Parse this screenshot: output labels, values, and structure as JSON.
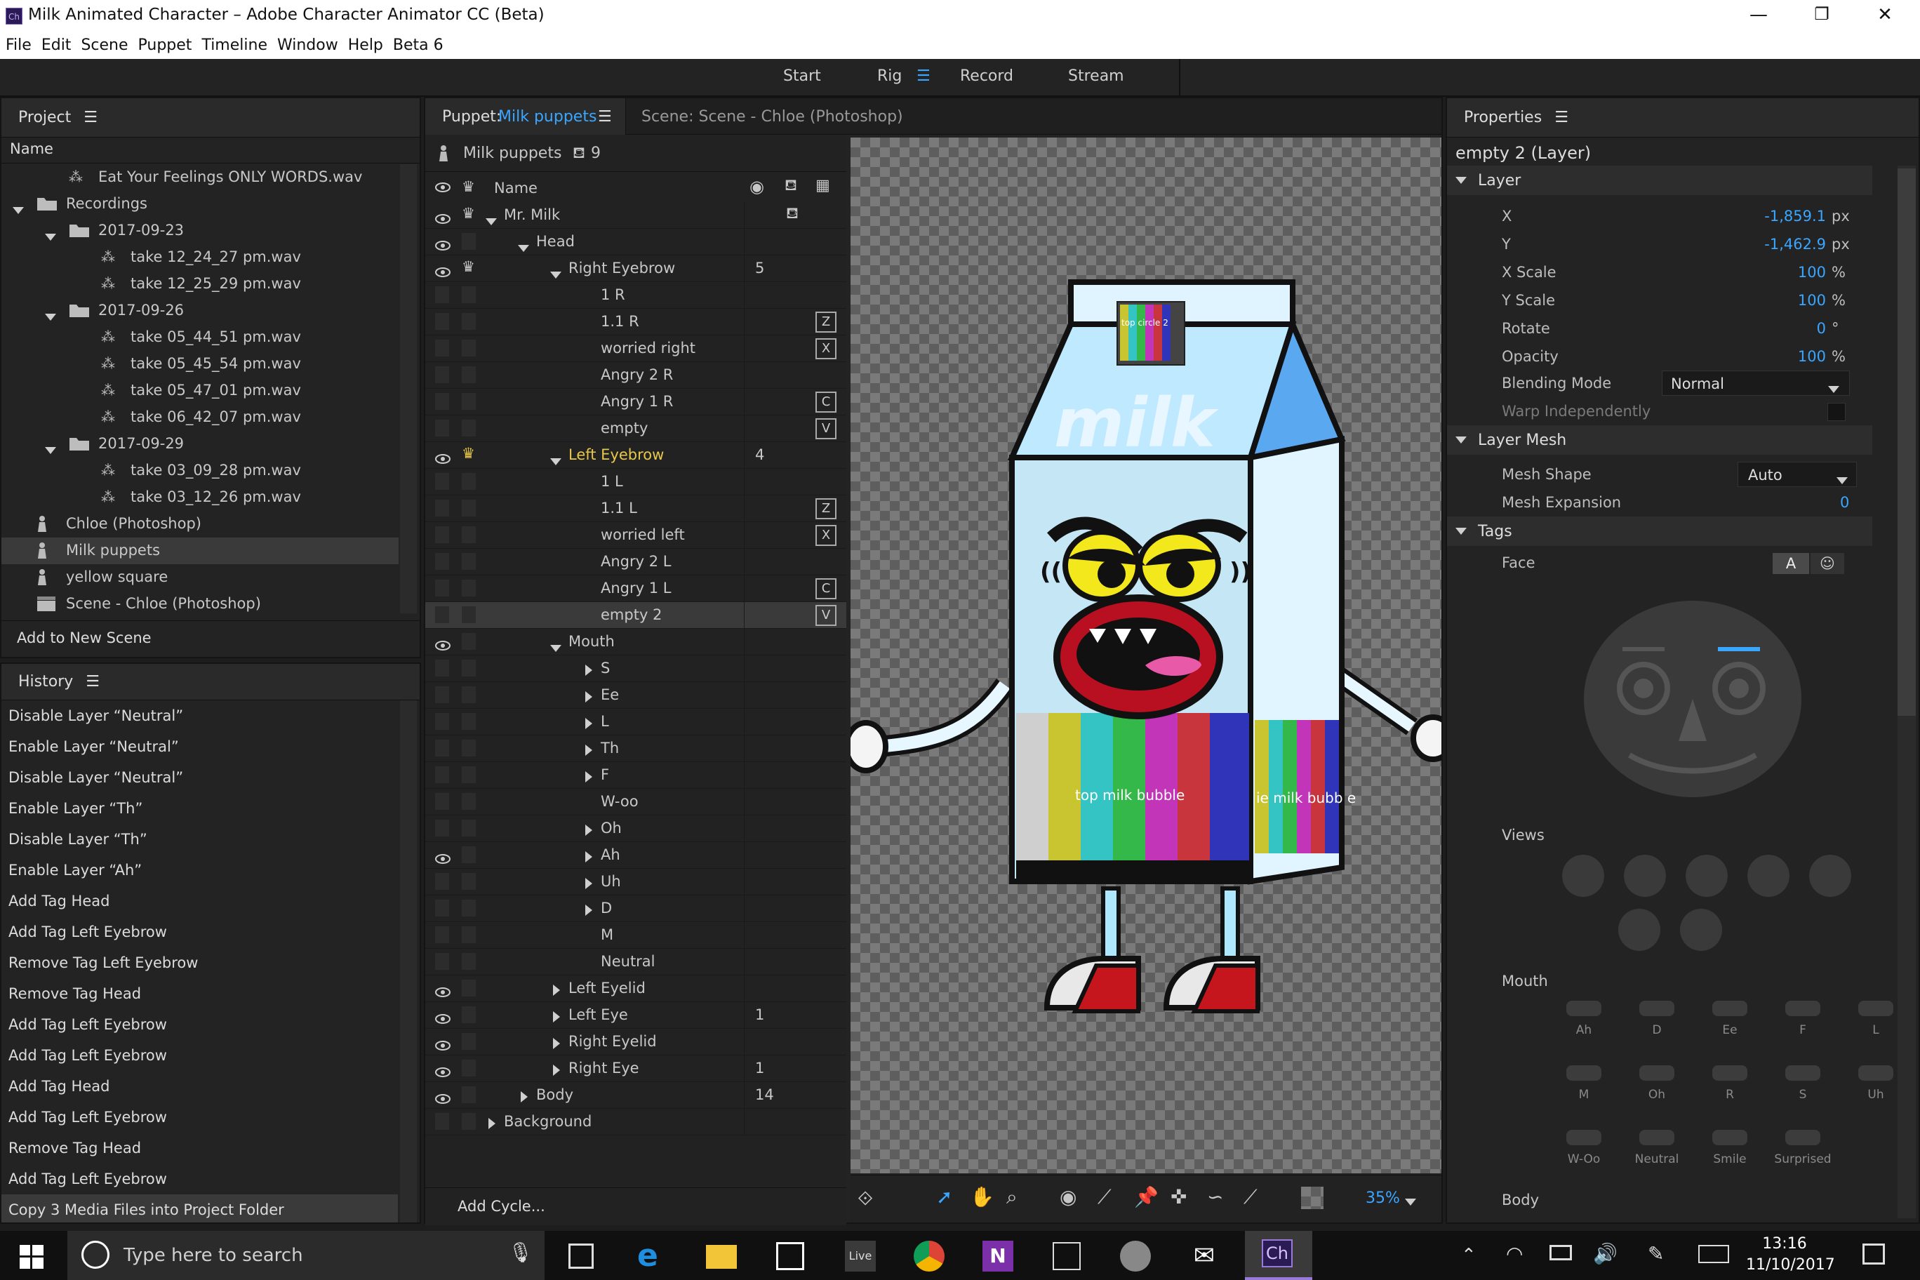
{
  "window": {
    "title": "Milk Animated Character – Adobe Character Animator CC (Beta)",
    "app_icon": "Ch"
  },
  "menu": [
    "File",
    "Edit",
    "Scene",
    "Puppet",
    "Timeline",
    "Window",
    "Help",
    "Beta 6"
  ],
  "workspace_tabs": [
    "Start",
    "Rig",
    "Record",
    "Stream"
  ],
  "project": {
    "title": "Project",
    "column": "Name",
    "items": [
      {
        "label": "Eat Your Feelings ONLY WORDS.wav",
        "depth": 1,
        "icon": "audio-icon"
      },
      {
        "label": "Recordings",
        "depth": 0,
        "icon": "folder-icon",
        "expanded": true
      },
      {
        "label": "2017-09-23",
        "depth": 1,
        "icon": "folder-icon",
        "expanded": true
      },
      {
        "label": "take 12_24_27 pm.wav",
        "depth": 2,
        "icon": "audio-icon"
      },
      {
        "label": "take 12_25_29 pm.wav",
        "depth": 2,
        "icon": "audio-icon"
      },
      {
        "label": "2017-09-26",
        "depth": 1,
        "icon": "folder-icon",
        "expanded": true
      },
      {
        "label": "take 05_44_51 pm.wav",
        "depth": 2,
        "icon": "audio-icon"
      },
      {
        "label": "take 05_45_54 pm.wav",
        "depth": 2,
        "icon": "audio-icon"
      },
      {
        "label": "take 05_47_01 pm.wav",
        "depth": 2,
        "icon": "audio-icon"
      },
      {
        "label": "take 06_42_07 pm.wav",
        "depth": 2,
        "icon": "audio-icon"
      },
      {
        "label": "2017-09-29",
        "depth": 1,
        "icon": "folder-icon",
        "expanded": true
      },
      {
        "label": "take 03_09_28 pm.wav",
        "depth": 2,
        "icon": "audio-icon"
      },
      {
        "label": "take 03_12_26 pm.wav",
        "depth": 2,
        "icon": "audio-icon"
      },
      {
        "label": "Chloe (Photoshop)",
        "depth": 0,
        "icon": "puppet-icon"
      },
      {
        "label": "Milk puppets",
        "depth": 0,
        "icon": "puppet-icon",
        "selected": true
      },
      {
        "label": "yellow square",
        "depth": 0,
        "icon": "puppet-icon"
      },
      {
        "label": "Scene - Chloe (Photoshop)",
        "depth": 0,
        "icon": "scene-icon"
      }
    ],
    "add_button": "Add to New Scene"
  },
  "history": {
    "title": "History",
    "items": [
      "Disable Layer “Neutral”",
      "Enable Layer “Neutral”",
      "Disable Layer “Neutral”",
      "Enable Layer “Th”",
      "Disable Layer “Th”",
      "Enable Layer “Ah”",
      "Add Tag Head",
      "Add Tag Left Eyebrow",
      "Remove Tag Left Eyebrow",
      "Remove Tag Head",
      "Add Tag Left Eyebrow",
      "Add Tag Left Eyebrow",
      "Add Tag Head",
      "Add Tag Left Eyebrow",
      "Remove Tag Head",
      "Add Tag Left Eyebrow",
      "Copy 3 Media Files into Project Folder"
    ]
  },
  "puppet_panel": {
    "tab_prefix": "Puppet:",
    "tab_name": "Milk puppets",
    "scene_tab": "Scene: Scene - Chloe (Photoshop)",
    "puppet_label": "Milk puppets",
    "puppet_count": "9",
    "column": "Name",
    "add_cycle": "Add Cycle...",
    "layers": [
      {
        "label": "Mr. Milk",
        "depth": 0,
        "arrow": "down",
        "eye": true,
        "crown": true,
        "count": ""
      },
      {
        "label": "Head",
        "depth": 1,
        "arrow": "down",
        "eye": true,
        "crown": false,
        "count": ""
      },
      {
        "label": "Right Eyebrow",
        "depth": 2,
        "arrow": "down",
        "eye": true,
        "crown": true,
        "count": "5"
      },
      {
        "label": "1 R",
        "depth": 3,
        "arrow": "",
        "eye": false,
        "count": "",
        "key": ""
      },
      {
        "label": "1.1 R",
        "depth": 3,
        "arrow": "",
        "eye": false,
        "count": "",
        "key": "Z"
      },
      {
        "label": "worried right",
        "depth": 3,
        "arrow": "",
        "eye": false,
        "count": "",
        "key": "X"
      },
      {
        "label": "Angry 2 R",
        "depth": 3,
        "arrow": "",
        "eye": false,
        "count": "",
        "key": ""
      },
      {
        "label": "Angry 1 R",
        "depth": 3,
        "arrow": "",
        "eye": false,
        "count": "",
        "key": "C"
      },
      {
        "label": "empty",
        "depth": 3,
        "arrow": "",
        "eye": false,
        "count": "",
        "key": "V"
      },
      {
        "label": "Left Eyebrow",
        "depth": 2,
        "arrow": "down",
        "eye": true,
        "crown": true,
        "count": "4",
        "highlight": true
      },
      {
        "label": "1 L",
        "depth": 3,
        "arrow": "",
        "eye": false,
        "count": "",
        "key": ""
      },
      {
        "label": "1.1 L",
        "depth": 3,
        "arrow": "",
        "eye": false,
        "count": "",
        "key": "Z"
      },
      {
        "label": "worried left",
        "depth": 3,
        "arrow": "",
        "eye": false,
        "count": "",
        "key": "X"
      },
      {
        "label": "Angry 2 L",
        "depth": 3,
        "arrow": "",
        "eye": false,
        "count": "",
        "key": ""
      },
      {
        "label": "Angry 1 L",
        "depth": 3,
        "arrow": "",
        "eye": false,
        "count": "",
        "key": "C"
      },
      {
        "label": "empty 2",
        "depth": 3,
        "arrow": "",
        "eye": false,
        "count": "",
        "key": "V",
        "selected": true
      },
      {
        "label": "Mouth",
        "depth": 2,
        "arrow": "down",
        "eye": true,
        "count": ""
      },
      {
        "label": "S",
        "depth": 3,
        "arrow": "right",
        "eye": false,
        "count": ""
      },
      {
        "label": "Ee",
        "depth": 3,
        "arrow": "right",
        "eye": false,
        "count": ""
      },
      {
        "label": "L",
        "depth": 3,
        "arrow": "right",
        "eye": false,
        "count": ""
      },
      {
        "label": "Th",
        "depth": 3,
        "arrow": "right",
        "eye": false,
        "count": ""
      },
      {
        "label": "F",
        "depth": 3,
        "arrow": "right",
        "eye": false,
        "count": ""
      },
      {
        "label": "W-oo",
        "depth": 3,
        "arrow": "",
        "eye": false,
        "count": ""
      },
      {
        "label": "Oh",
        "depth": 3,
        "arrow": "right",
        "eye": false,
        "count": ""
      },
      {
        "label": "Ah",
        "depth": 3,
        "arrow": "right",
        "eye": true,
        "count": ""
      },
      {
        "label": "Uh",
        "depth": 3,
        "arrow": "right",
        "eye": false,
        "count": ""
      },
      {
        "label": "D",
        "depth": 3,
        "arrow": "right",
        "eye": false,
        "count": ""
      },
      {
        "label": "M",
        "depth": 3,
        "arrow": "",
        "eye": false,
        "count": ""
      },
      {
        "label": "Neutral",
        "depth": 3,
        "arrow": "",
        "eye": false,
        "count": ""
      },
      {
        "label": "Left Eyelid",
        "depth": 2,
        "arrow": "right",
        "eye": true,
        "count": ""
      },
      {
        "label": "Left Eye",
        "depth": 2,
        "arrow": "right",
        "eye": true,
        "count": "1"
      },
      {
        "label": "Right Eyelid",
        "depth": 2,
        "arrow": "right",
        "eye": true,
        "count": ""
      },
      {
        "label": "Right Eye",
        "depth": 2,
        "arrow": "right",
        "eye": true,
        "count": "1"
      },
      {
        "label": "Body",
        "depth": 1,
        "arrow": "right",
        "eye": true,
        "count": "14"
      },
      {
        "label": "Background",
        "depth": 0,
        "arrow": "right",
        "eye": false,
        "count": ""
      }
    ]
  },
  "canvas": {
    "zoom": "35%",
    "carton_label_top": "top circle 2",
    "carton_text": "milk",
    "bubble_front": "top milk bubble",
    "bubble_side": "ie milk bubb e"
  },
  "properties": {
    "title": "Properties",
    "layer_name": "empty 2 (Layer)",
    "layer_section": "Layer",
    "fields": [
      {
        "label": "X",
        "value": "-1,859.1",
        "unit": "px"
      },
      {
        "label": "Y",
        "value": "-1,462.9",
        "unit": "px"
      },
      {
        "label": "X Scale",
        "value": "100",
        "unit": "%"
      },
      {
        "label": "Y Scale",
        "value": "100",
        "unit": "%"
      },
      {
        "label": "Rotate",
        "value": "0",
        "unit": "°"
      },
      {
        "label": "Opacity",
        "value": "100",
        "unit": "%"
      }
    ],
    "blend_label": "Blending Mode",
    "blend_value": "Normal",
    "warp_label": "Warp Independently",
    "mesh_section": "Layer Mesh",
    "mesh_shape_label": "Mesh Shape",
    "mesh_shape_value": "Auto",
    "mesh_expansion_label": "Mesh Expansion",
    "mesh_expansion_value": "0",
    "tags_section": "Tags",
    "face_label": "Face",
    "face_btn_a": "A",
    "views_label": "Views",
    "mouth_label": "Mouth",
    "mouth_tags": [
      "Ah",
      "D",
      "Ee",
      "F",
      "L",
      "M",
      "Oh",
      "R",
      "S",
      "Uh",
      "W-Oo",
      "Neutral",
      "Smile",
      "Surprised"
    ],
    "body_label": "Body"
  },
  "taskbar": {
    "search_placeholder": "Type here to search",
    "time": "13:16",
    "date": "11/10/2017",
    "app_live": "Live",
    "app_ch": "Ch"
  },
  "colors": {
    "accent": "#3aa6ff",
    "highlight": "#e8c84a",
    "panel": "#232323"
  }
}
